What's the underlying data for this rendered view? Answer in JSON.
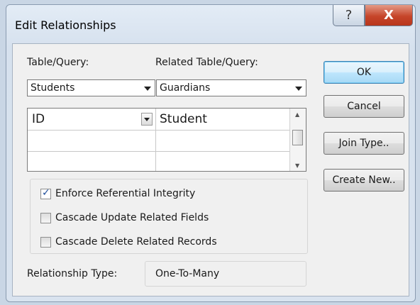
{
  "dialog": {
    "title": "Edit Relationships",
    "help_glyph": "?",
    "close_glyph": "X"
  },
  "form": {
    "table_label": "Table/Query:",
    "related_label": "Related Table/Query:",
    "table_value": "Students",
    "related_value": "Guardians",
    "grid_rows": [
      {
        "left": "ID",
        "right": "Student"
      },
      {
        "left": "",
        "right": ""
      },
      {
        "left": "",
        "right": ""
      }
    ],
    "options": [
      {
        "label": "Enforce Referential Integrity",
        "checked": true
      },
      {
        "label": "Cascade Update Related Fields",
        "checked": false
      },
      {
        "label": "Cascade Delete Related Records",
        "checked": false
      }
    ],
    "relationship_type_label": "Relationship Type:",
    "relationship_type_value": "One-To-Many"
  },
  "buttons": {
    "ok": "OK",
    "cancel": "Cancel",
    "join_type": "Join Type..",
    "create_new": "Create New.."
  },
  "colors": {
    "accent": "#3c7fb1",
    "close": "#c6452a"
  }
}
